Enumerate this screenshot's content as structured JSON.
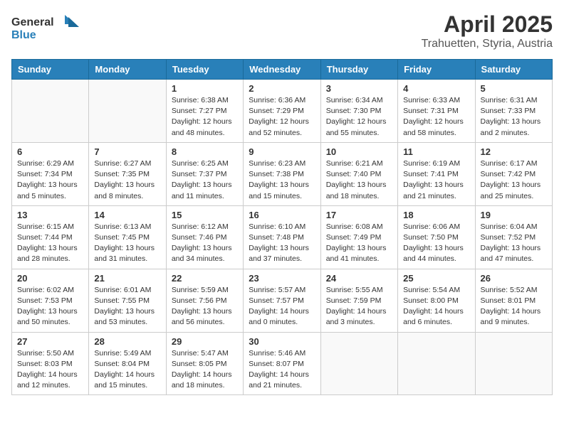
{
  "header": {
    "logo_general": "General",
    "logo_blue": "Blue",
    "title": "April 2025",
    "subtitle": "Trahuetten, Styria, Austria"
  },
  "weekdays": [
    "Sunday",
    "Monday",
    "Tuesday",
    "Wednesday",
    "Thursday",
    "Friday",
    "Saturday"
  ],
  "weeks": [
    [
      {
        "day": "",
        "empty": true
      },
      {
        "day": "",
        "empty": true
      },
      {
        "day": "1",
        "sunrise": "6:38 AM",
        "sunset": "7:27 PM",
        "daylight": "12 hours and 48 minutes."
      },
      {
        "day": "2",
        "sunrise": "6:36 AM",
        "sunset": "7:29 PM",
        "daylight": "12 hours and 52 minutes."
      },
      {
        "day": "3",
        "sunrise": "6:34 AM",
        "sunset": "7:30 PM",
        "daylight": "12 hours and 55 minutes."
      },
      {
        "day": "4",
        "sunrise": "6:33 AM",
        "sunset": "7:31 PM",
        "daylight": "12 hours and 58 minutes."
      },
      {
        "day": "5",
        "sunrise": "6:31 AM",
        "sunset": "7:33 PM",
        "daylight": "13 hours and 2 minutes."
      }
    ],
    [
      {
        "day": "6",
        "sunrise": "6:29 AM",
        "sunset": "7:34 PM",
        "daylight": "13 hours and 5 minutes."
      },
      {
        "day": "7",
        "sunrise": "6:27 AM",
        "sunset": "7:35 PM",
        "daylight": "13 hours and 8 minutes."
      },
      {
        "day": "8",
        "sunrise": "6:25 AM",
        "sunset": "7:37 PM",
        "daylight": "13 hours and 11 minutes."
      },
      {
        "day": "9",
        "sunrise": "6:23 AM",
        "sunset": "7:38 PM",
        "daylight": "13 hours and 15 minutes."
      },
      {
        "day": "10",
        "sunrise": "6:21 AM",
        "sunset": "7:40 PM",
        "daylight": "13 hours and 18 minutes."
      },
      {
        "day": "11",
        "sunrise": "6:19 AM",
        "sunset": "7:41 PM",
        "daylight": "13 hours and 21 minutes."
      },
      {
        "day": "12",
        "sunrise": "6:17 AM",
        "sunset": "7:42 PM",
        "daylight": "13 hours and 25 minutes."
      }
    ],
    [
      {
        "day": "13",
        "sunrise": "6:15 AM",
        "sunset": "7:44 PM",
        "daylight": "13 hours and 28 minutes."
      },
      {
        "day": "14",
        "sunrise": "6:13 AM",
        "sunset": "7:45 PM",
        "daylight": "13 hours and 31 minutes."
      },
      {
        "day": "15",
        "sunrise": "6:12 AM",
        "sunset": "7:46 PM",
        "daylight": "13 hours and 34 minutes."
      },
      {
        "day": "16",
        "sunrise": "6:10 AM",
        "sunset": "7:48 PM",
        "daylight": "13 hours and 37 minutes."
      },
      {
        "day": "17",
        "sunrise": "6:08 AM",
        "sunset": "7:49 PM",
        "daylight": "13 hours and 41 minutes."
      },
      {
        "day": "18",
        "sunrise": "6:06 AM",
        "sunset": "7:50 PM",
        "daylight": "13 hours and 44 minutes."
      },
      {
        "day": "19",
        "sunrise": "6:04 AM",
        "sunset": "7:52 PM",
        "daylight": "13 hours and 47 minutes."
      }
    ],
    [
      {
        "day": "20",
        "sunrise": "6:02 AM",
        "sunset": "7:53 PM",
        "daylight": "13 hours and 50 minutes."
      },
      {
        "day": "21",
        "sunrise": "6:01 AM",
        "sunset": "7:55 PM",
        "daylight": "13 hours and 53 minutes."
      },
      {
        "day": "22",
        "sunrise": "5:59 AM",
        "sunset": "7:56 PM",
        "daylight": "13 hours and 56 minutes."
      },
      {
        "day": "23",
        "sunrise": "5:57 AM",
        "sunset": "7:57 PM",
        "daylight": "14 hours and 0 minutes."
      },
      {
        "day": "24",
        "sunrise": "5:55 AM",
        "sunset": "7:59 PM",
        "daylight": "14 hours and 3 minutes."
      },
      {
        "day": "25",
        "sunrise": "5:54 AM",
        "sunset": "8:00 PM",
        "daylight": "14 hours and 6 minutes."
      },
      {
        "day": "26",
        "sunrise": "5:52 AM",
        "sunset": "8:01 PM",
        "daylight": "14 hours and 9 minutes."
      }
    ],
    [
      {
        "day": "27",
        "sunrise": "5:50 AM",
        "sunset": "8:03 PM",
        "daylight": "14 hours and 12 minutes."
      },
      {
        "day": "28",
        "sunrise": "5:49 AM",
        "sunset": "8:04 PM",
        "daylight": "14 hours and 15 minutes."
      },
      {
        "day": "29",
        "sunrise": "5:47 AM",
        "sunset": "8:05 PM",
        "daylight": "14 hours and 18 minutes."
      },
      {
        "day": "30",
        "sunrise": "5:46 AM",
        "sunset": "8:07 PM",
        "daylight": "14 hours and 21 minutes."
      },
      {
        "day": "",
        "empty": true
      },
      {
        "day": "",
        "empty": true
      },
      {
        "day": "",
        "empty": true
      }
    ]
  ]
}
